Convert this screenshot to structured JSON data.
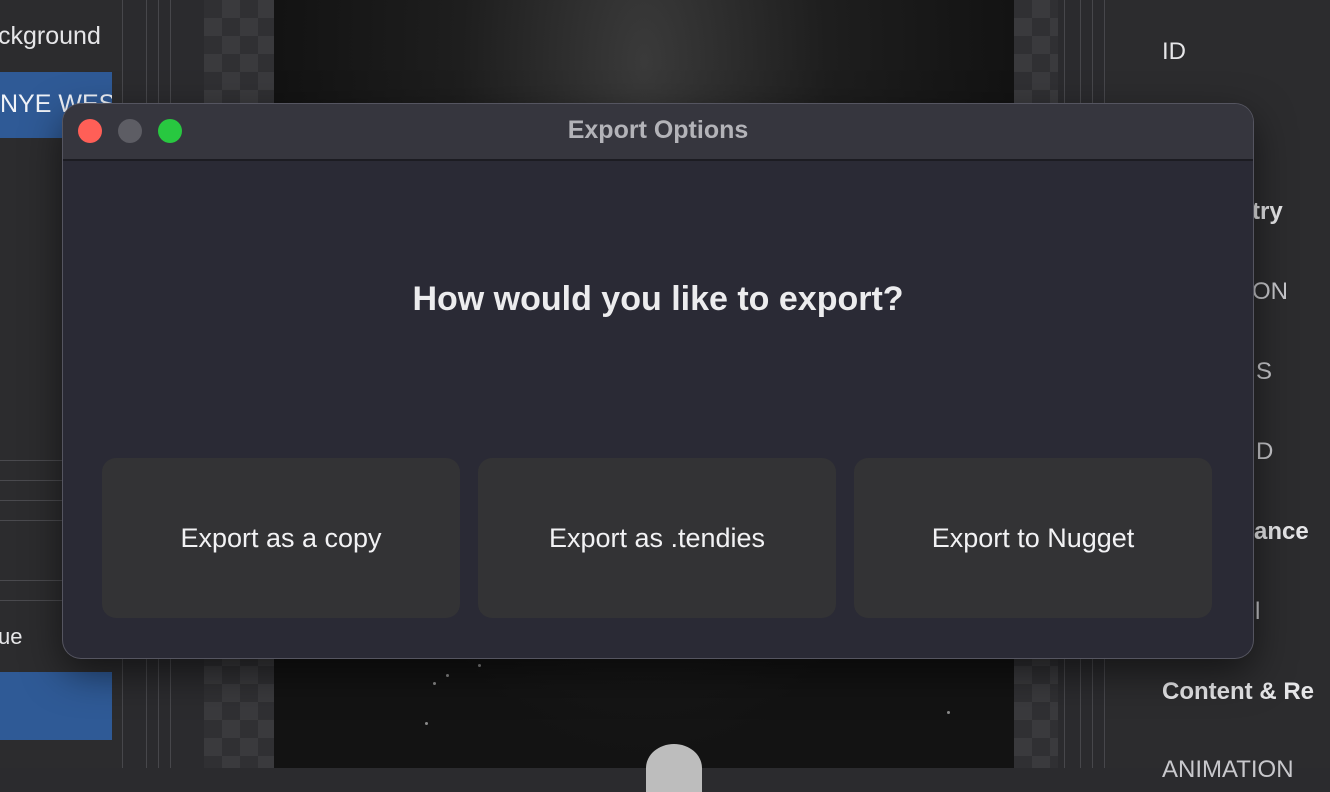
{
  "background": {
    "left_panel": {
      "top_label": "ckground",
      "selected_item": "NYE WEST",
      "bottom_label": "ue"
    },
    "right_panel": {
      "items": [
        "ID",
        "try",
        "ON",
        "S",
        "D",
        "ance",
        "l",
        "Content & Re",
        "ANIMATION"
      ]
    }
  },
  "dialog": {
    "title": "Export Options",
    "prompt": "How would you like to export?",
    "options": [
      {
        "label": "Export as a copy"
      },
      {
        "label": "Export as .tendies"
      },
      {
        "label": "Export to Nugget"
      }
    ],
    "controls": {
      "close": "close",
      "minimize": "minimize",
      "zoom": "zoom"
    }
  },
  "colors": {
    "close": "#ff5f57",
    "minimize": "#5d5d64",
    "zoom": "#28c840",
    "selection": "#2f5a96",
    "dialog_bg": "#2a2a35",
    "button_bg": "#333335"
  }
}
